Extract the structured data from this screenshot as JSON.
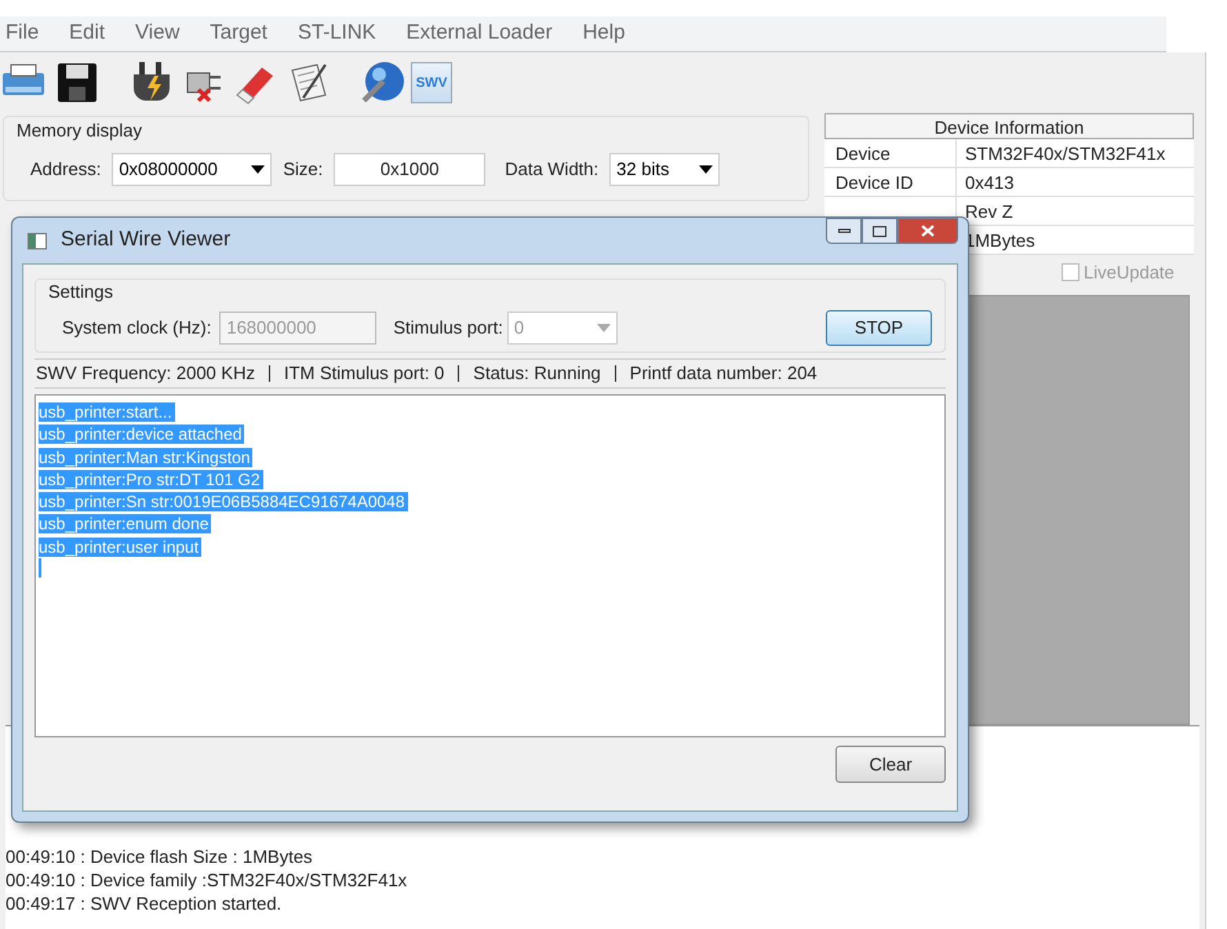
{
  "menu": [
    "File",
    "Edit",
    "View",
    "Target",
    "ST-LINK",
    "External Loader",
    "Help"
  ],
  "toolbar": [
    {
      "kind": "open"
    },
    {
      "kind": "save"
    },
    {
      "kind": "connect"
    },
    {
      "kind": "disconnect"
    },
    {
      "kind": "erase"
    },
    {
      "kind": "program"
    },
    {
      "kind": "update"
    },
    {
      "kind": "swv",
      "label": "SWV"
    }
  ],
  "memory_display": {
    "title": "Memory display",
    "address_label": "Address:",
    "address": "0x08000000",
    "size_label": "Size:",
    "size": "0x1000",
    "width_label": "Data Width:",
    "width": "32 bits"
  },
  "device_info": {
    "title": "Device Information",
    "rows": [
      {
        "label": "Device",
        "value": "STM32F40x/STM32F41x"
      },
      {
        "label": "Device ID",
        "value": "0x413"
      },
      {
        "value": "Rev Z"
      },
      {
        "value": "1MBytes"
      }
    ]
  },
  "live_update": {
    "label": "LiveUpdate",
    "checked": false
  },
  "log": [
    "00:49:10 : Device flash Size : 1MBytes",
    "00:49:10 : Device family :STM32F40x/STM32F41x",
    "00:49:17 : SWV Reception started."
  ],
  "swv_dialog": {
    "title": "Serial Wire Viewer",
    "settings_title": "Settings",
    "clock_label": "System clock (Hz):",
    "clock": "168000000",
    "port_label": "Stimulus port:",
    "port": "0",
    "stop": "STOP",
    "status": [
      "SWV Frequency: 2000 KHz",
      "ITM Stimulus port: 0",
      "Status: Running",
      "Printf data number: 204"
    ],
    "output": [
      "usb_printer:start...",
      "usb_printer:device attached",
      "usb_printer:Man str:Kingston",
      "usb_printer:Pro str:DT 101 G2",
      "usb_printer:Sn str:0019E06B5884EC91674A0048",
      "usb_printer:enum done",
      "usb_printer:user input"
    ],
    "clear": "Clear"
  }
}
